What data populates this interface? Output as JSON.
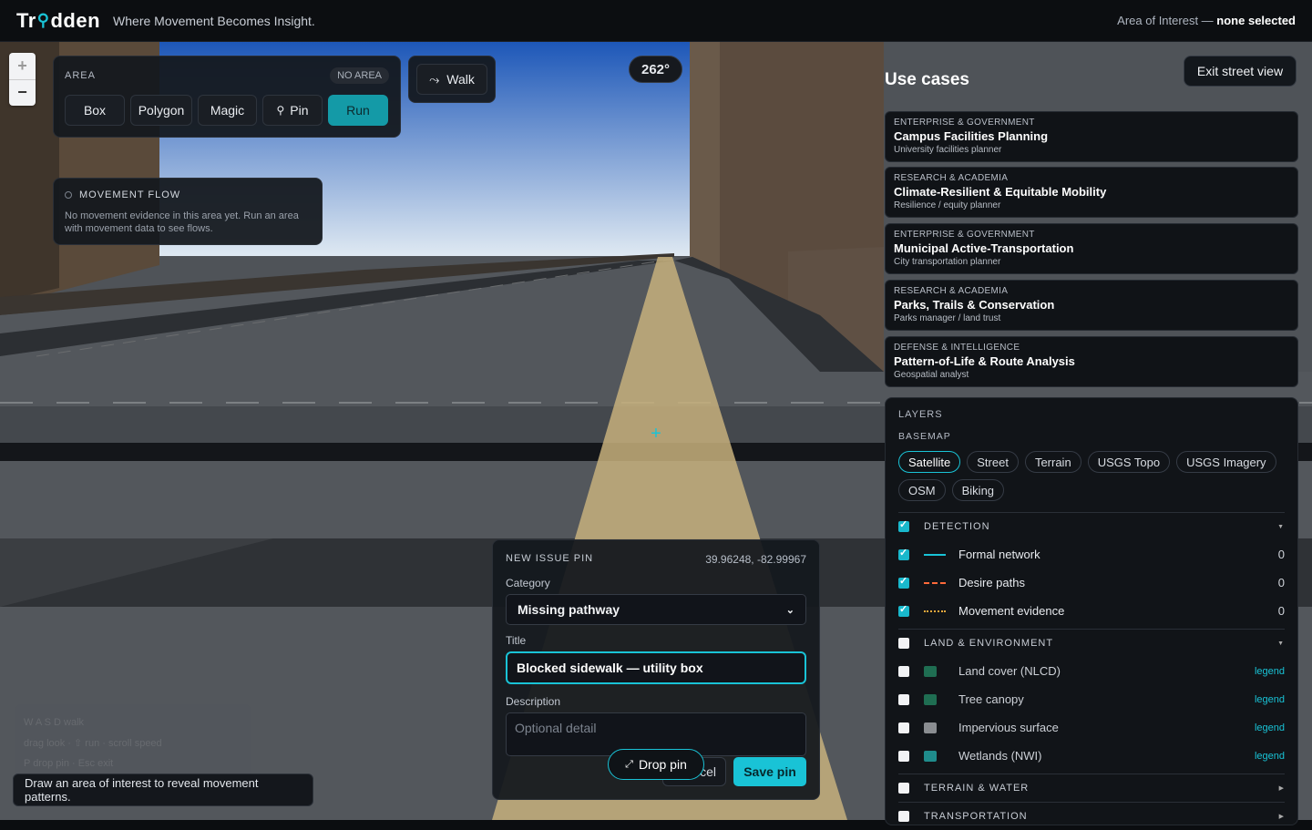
{
  "header": {
    "logo_left": "Tr",
    "logo_right": "dden",
    "tagline": "Where Movement Becomes Insight.",
    "aoi_label": "Area of Interest —",
    "aoi_value": "none selected"
  },
  "zoom": {
    "in": "+",
    "out": "−"
  },
  "area_panel": {
    "label": "AREA",
    "badge": "NO AREA",
    "buttons": [
      "Box",
      "Polygon",
      "Magic",
      "Pin",
      "Run"
    ]
  },
  "walk": {
    "label": "Walk"
  },
  "heading": "262°",
  "flow": {
    "title": "MOVEMENT FLOW",
    "text": "No movement evidence in this area yet. Run an area with movement data to see flows."
  },
  "hints": {
    "line1": "W A S D walk",
    "line2": "drag look · ⇧ run · scroll speed",
    "line3": "P drop pin · Esc exit"
  },
  "toast": "Draw an area of interest to reveal movement patterns.",
  "issue": {
    "title": "NEW ISSUE PIN",
    "coords": "39.96248, -82.99967",
    "category_label": "Category",
    "category_value": "Missing pathway",
    "title_label": "Title",
    "title_value": "Blocked sidewalk — utility box",
    "description_label": "Description",
    "description_placeholder": "Optional detail",
    "cancel": "cel",
    "save": "Save pin",
    "drop_pin": "Drop pin"
  },
  "usecases": {
    "title": "Use cases",
    "exit": "Exit street view",
    "items": [
      {
        "category": "ENTERPRISE & GOVERNMENT",
        "name": "Campus Facilities Planning",
        "role": "University facilities planner"
      },
      {
        "category": "RESEARCH & ACADEMIA",
        "name": "Climate-Resilient & Equitable Mobility",
        "role": "Resilience / equity planner"
      },
      {
        "category": "ENTERPRISE & GOVERNMENT",
        "name": "Municipal Active-Transportation",
        "role": "City transportation planner"
      },
      {
        "category": "RESEARCH & ACADEMIA",
        "name": "Parks, Trails & Conservation",
        "role": "Parks manager / land trust"
      },
      {
        "category": "DEFENSE & INTELLIGENCE",
        "name": "Pattern-of-Life & Route Analysis",
        "role": "Geospatial analyst"
      }
    ]
  },
  "layers": {
    "title": "LAYERS",
    "basemap_label": "BASEMAP",
    "basemaps": [
      "Satellite",
      "Street",
      "Terrain",
      "USGS Topo",
      "USGS Imagery",
      "OSM",
      "Biking"
    ],
    "detection": {
      "label": "DETECTION",
      "items": [
        {
          "name": "Formal network",
          "count": "0"
        },
        {
          "name": "Desire paths",
          "count": "0"
        },
        {
          "name": "Movement evidence",
          "count": "0"
        }
      ]
    },
    "land": {
      "label": "LAND & ENVIRONMENT",
      "items": [
        {
          "name": "Land cover (NLCD)",
          "link": "legend",
          "color": "#1f6e52"
        },
        {
          "name": "Tree canopy",
          "link": "legend",
          "color": "#1f6e52"
        },
        {
          "name": "Impervious surface",
          "link": "legend",
          "color": "#8a8d91"
        },
        {
          "name": "Wetlands (NWI)",
          "link": "legend",
          "color": "#1f8c8c"
        }
      ]
    },
    "terrain_label": "TERRAIN & WATER",
    "transport_label": "TRANSPORTATION"
  }
}
